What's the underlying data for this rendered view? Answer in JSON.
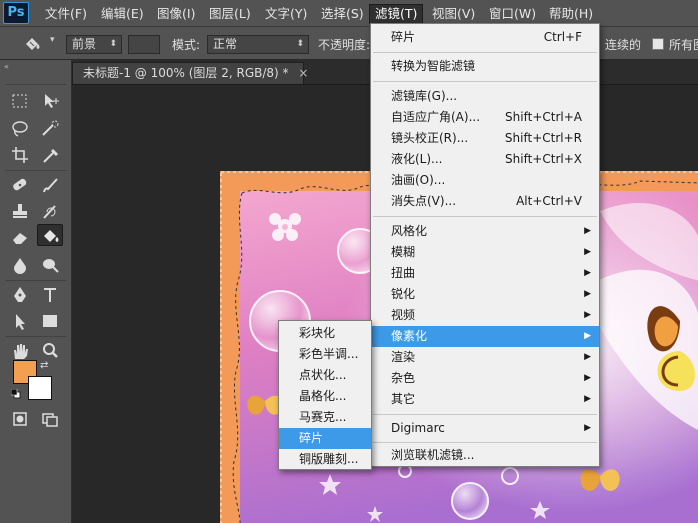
{
  "app": {
    "logo": "Ps"
  },
  "menubar": {
    "items": [
      "文件(F)",
      "编辑(E)",
      "图像(I)",
      "图层(L)",
      "文字(Y)",
      "选择(S)",
      "滤镜(T)",
      "视图(V)",
      "窗口(W)",
      "帮助(H)"
    ],
    "active": "滤镜(T)"
  },
  "options": {
    "foreground_value": "前景",
    "mode_label": "模式:",
    "mode_value": "正常",
    "opacity_label": "不透明度:",
    "contiguous_label": "连续的",
    "all_layers_label": "所有图"
  },
  "tab": {
    "title": "未标题-1 @ 100% (图层 2, RGB/8) *",
    "close": "×"
  },
  "filter_menu": {
    "items": [
      {
        "label": "碎片",
        "shortcut": "Ctrl+F"
      },
      {
        "label": "转换为智能滤镜"
      },
      {
        "label": "滤镜库(G)..."
      },
      {
        "label": "自适应广角(A)...",
        "shortcut": "Shift+Ctrl+A"
      },
      {
        "label": "镜头校正(R)...",
        "shortcut": "Shift+Ctrl+R"
      },
      {
        "label": "液化(L)...",
        "shortcut": "Shift+Ctrl+X"
      },
      {
        "label": "油画(O)..."
      },
      {
        "label": "消失点(V)...",
        "shortcut": "Alt+Ctrl+V"
      },
      {
        "label": "风格化"
      },
      {
        "label": "模糊"
      },
      {
        "label": "扭曲"
      },
      {
        "label": "锐化"
      },
      {
        "label": "视频"
      },
      {
        "label": "像素化"
      },
      {
        "label": "渲染"
      },
      {
        "label": "杂色"
      },
      {
        "label": "其它"
      },
      {
        "label": "Digimarc"
      },
      {
        "label": "浏览联机滤镜..."
      }
    ],
    "highlighted": "像素化"
  },
  "pixelate_submenu": {
    "items": [
      "彩块化",
      "彩色半调...",
      "点状化...",
      "晶格化...",
      "马赛克...",
      "碎片",
      "铜版雕刻..."
    ],
    "highlighted": "碎片"
  },
  "toolbox": {
    "foreground_color": "#f0a050",
    "background_color": "#ffffff"
  },
  "colors": {
    "menu_highlight": "#3d9ae8",
    "ui_panel": "#535353",
    "canvas_bg": "#282828"
  }
}
